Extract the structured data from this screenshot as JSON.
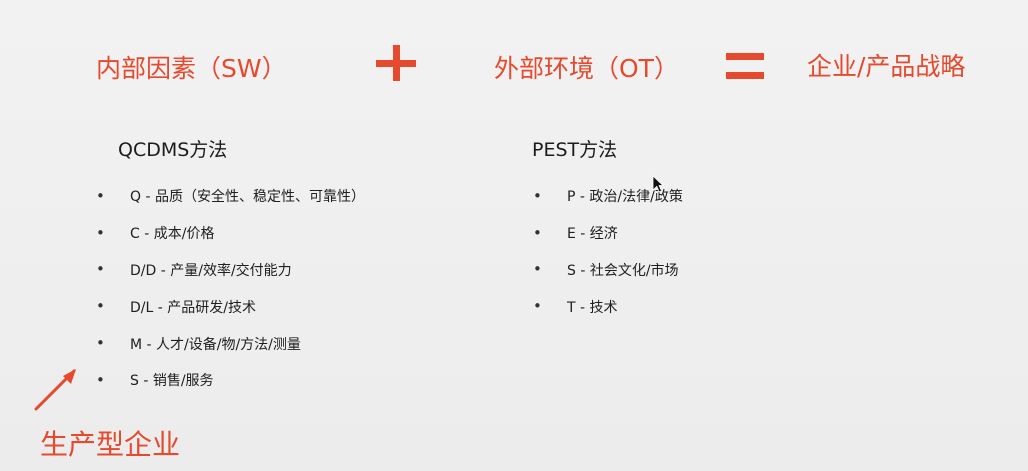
{
  "colors": {
    "accent": "#e64a2e",
    "background": "#eeeeee",
    "text": "#222222"
  },
  "formula": {
    "internal": "内部因素（SW）",
    "external": "外部环境（OT）",
    "result": "企业/产品战略"
  },
  "sections": {
    "left": {
      "title": "QCDMS方法",
      "items": [
        {
          "bullet": "•",
          "text": "Q - 品质（安全性、稳定性、可靠性）"
        },
        {
          "bullet": "•",
          "text": "C - 成本/价格"
        },
        {
          "bullet": "•",
          "text": "D/D - 产量/效率/交付能力"
        },
        {
          "bullet": "•",
          "text": "D/L - 产品研发/技术"
        },
        {
          "bullet": "•",
          "text": "M - 人才/设备/物/方法/测量"
        },
        {
          "bullet": "•",
          "text": "S - 销售/服务"
        }
      ]
    },
    "right": {
      "title": "PEST方法",
      "items": [
        {
          "bullet": "•",
          "text": "P - 政治/法律/政策"
        },
        {
          "bullet": "•",
          "text": "E - 经济"
        },
        {
          "bullet": "•",
          "text": "S - 社会文化/市场"
        },
        {
          "bullet": "•",
          "text": "T - 技术"
        }
      ]
    }
  },
  "annotation": {
    "label": "生产型企业",
    "icon": "arrow-icon"
  },
  "cursor": {
    "icon": "mouse-pointer-icon"
  }
}
